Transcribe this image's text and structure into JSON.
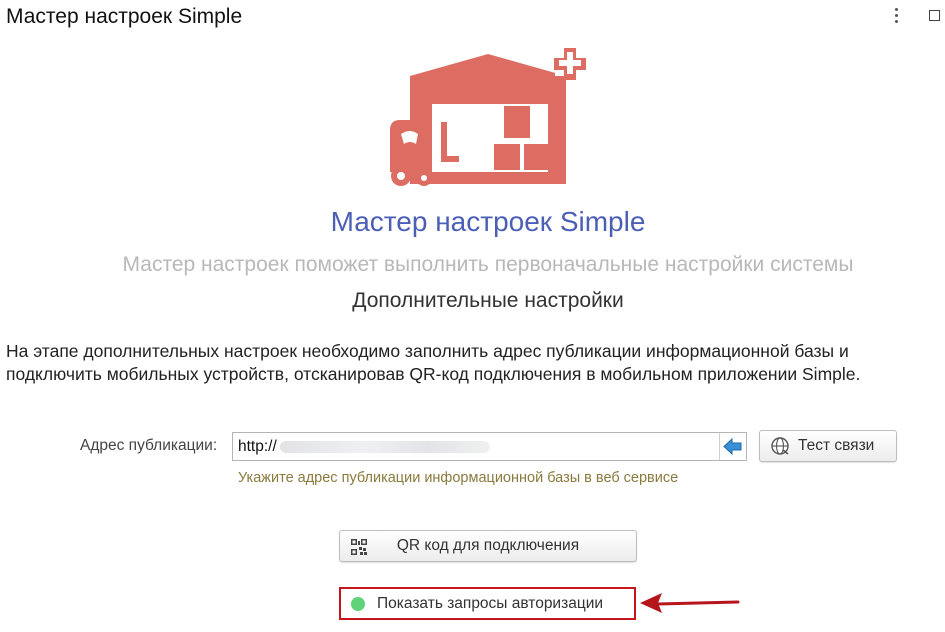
{
  "window": {
    "title": "Мастер настроек Simple"
  },
  "header": {
    "heading": "Мастер настроек Simple",
    "subheading": "Мастер настроек поможет выполнить первоначальные настройки системы",
    "step_title": "Дополнительные настройки"
  },
  "description": "На этапе дополнительных настроек необходимо заполнить адрес публикации информационной базы и подключить мобильных устройств, отсканировав QR-код подключения в мобильном приложении Simple.",
  "publication": {
    "label": "Адрес публикации:",
    "value": "http://",
    "hint": "Укажите адрес публикации информационной базы в веб сервисе"
  },
  "buttons": {
    "test_connection": "Тест связи",
    "qr_code": "QR код для подключения",
    "show_auth_requests": "Показать запросы авторизации"
  },
  "colors": {
    "logo": "#dd6c62",
    "heading": "#4a5fb5",
    "hint": "#8a7a3e",
    "highlight": "#c3151b",
    "status_dot": "#5fd27a"
  },
  "icons": {
    "logo": "warehouse-forklift-logo",
    "go": "arrow-left-icon",
    "test": "globe-connection-icon",
    "qr": "qr-code-icon",
    "status": "green-status-dot",
    "pointer": "red-arrow-pointer"
  }
}
